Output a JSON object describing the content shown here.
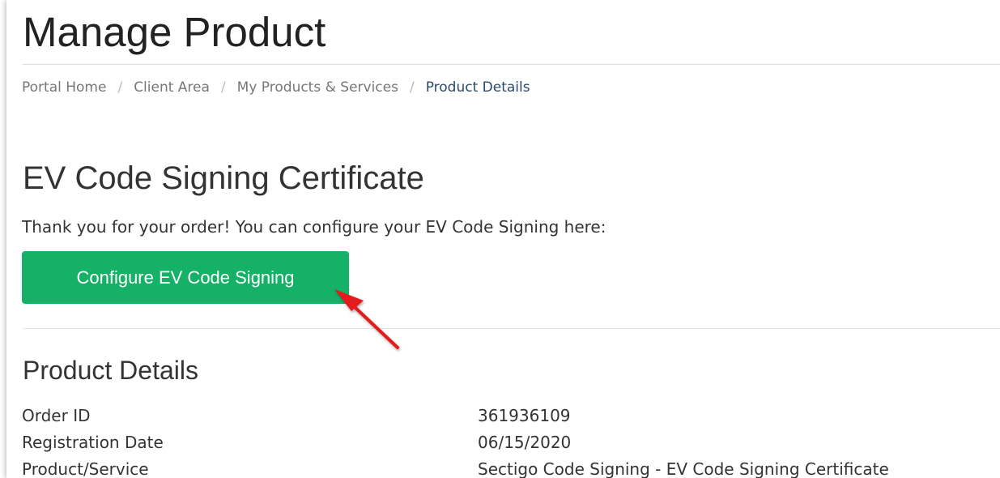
{
  "header": {
    "title": "Manage Product"
  },
  "breadcrumb": {
    "items": [
      "Portal Home",
      "Client Area",
      "My Products & Services",
      "Product Details"
    ],
    "separator": "/"
  },
  "product": {
    "title": "EV Code Signing Certificate",
    "intro": "Thank you for your order! You can configure your EV Code Signing here:",
    "configure_button": "Configure EV Code Signing"
  },
  "details": {
    "title": "Product Details",
    "rows": [
      {
        "label": "Order ID",
        "value": "361936109"
      },
      {
        "label": "Registration Date",
        "value": "06/15/2020"
      },
      {
        "label": "Product/Service",
        "value": "Sectigo Code Signing - EV Code Signing Certificate"
      }
    ]
  },
  "colors": {
    "button_green": "#14b167",
    "breadcrumb_active": "#2b4a6b",
    "annotation_arrow": "#e01b1b"
  },
  "icons": {
    "annotation": "red-arrow-icon"
  }
}
